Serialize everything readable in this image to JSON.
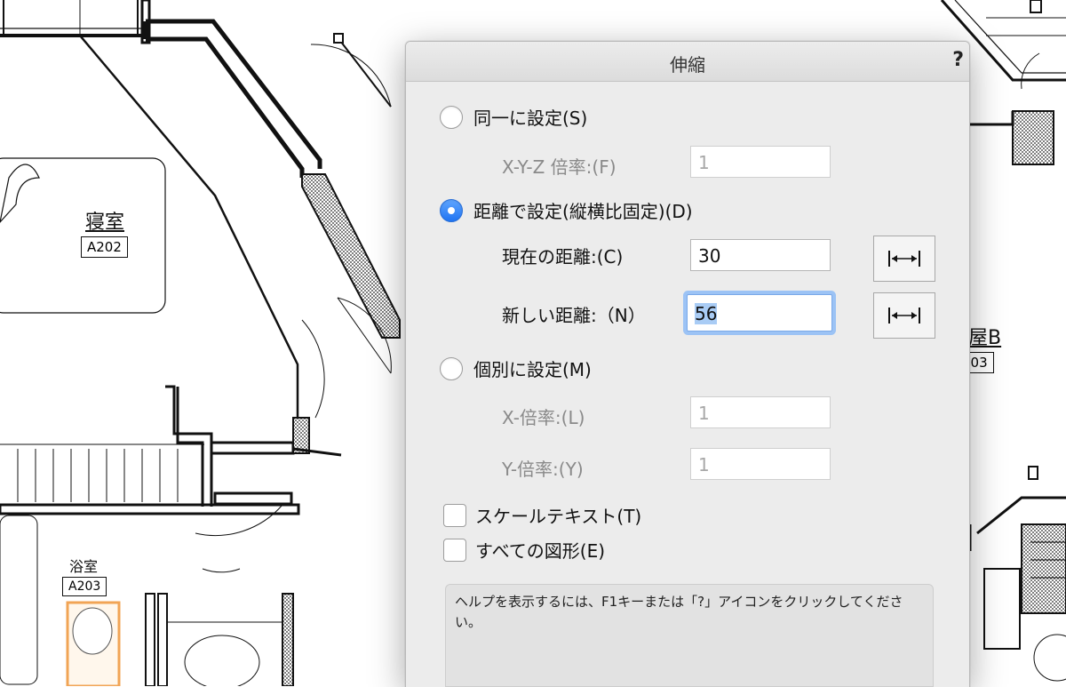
{
  "background": {
    "rooms": [
      {
        "name": "寝室",
        "tag": "A202"
      },
      {
        "name": "浴室",
        "tag": "A203"
      },
      {
        "name": "部屋B",
        "tag": "203"
      }
    ]
  },
  "dialog": {
    "title": "伸縮",
    "help_button": "?",
    "option_uniform": {
      "label": "同一に設定(S)",
      "selected": false
    },
    "xyz_scale": {
      "label": "X-Y-Z 倍率:(F)",
      "value": "1"
    },
    "option_distance": {
      "label": "距離で設定(縦横比固定)(D)",
      "selected": true
    },
    "current_distance": {
      "label": "現在の距離:(C)",
      "value": "30"
    },
    "new_distance": {
      "label": "新しい距離:（N）",
      "value": "56"
    },
    "option_separate": {
      "label": "個別に設定(M)",
      "selected": false
    },
    "x_scale": {
      "label": "X-倍率:(L)",
      "value": "1"
    },
    "y_scale": {
      "label": "Y-倍率:(Y)",
      "value": "1"
    },
    "scale_text": {
      "label": "スケールテキスト(T)",
      "checked": false
    },
    "all_objects": {
      "label": "すべての図形(E)",
      "checked": false
    },
    "help_text": "ヘルプを表示するには、F1キーまたは「?」アイコンをクリックしてください。"
  },
  "colors": {
    "accent": "#1f74f2",
    "focus_ring": "#9cc3f5",
    "selection": "#a9ccf5",
    "dialog_bg": "#ececec"
  },
  "icons": [
    "dimension-pick-icon",
    "dimension-pick-icon"
  ]
}
